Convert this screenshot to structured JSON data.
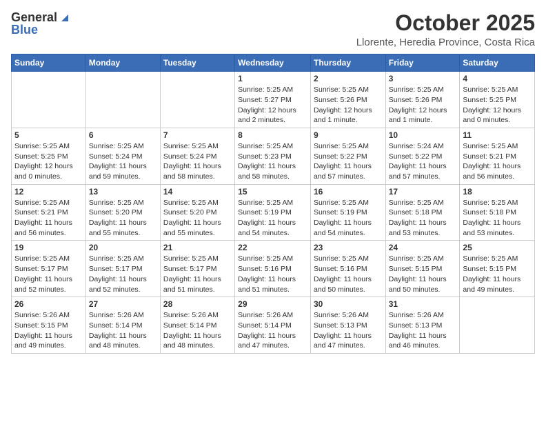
{
  "logo": {
    "general": "General",
    "blue": "Blue"
  },
  "title": "October 2025",
  "location": "Llorente, Heredia Province, Costa Rica",
  "weekdays": [
    "Sunday",
    "Monday",
    "Tuesday",
    "Wednesday",
    "Thursday",
    "Friday",
    "Saturday"
  ],
  "weeks": [
    [
      {
        "day": "",
        "info": ""
      },
      {
        "day": "",
        "info": ""
      },
      {
        "day": "",
        "info": ""
      },
      {
        "day": "1",
        "info": "Sunrise: 5:25 AM\nSunset: 5:27 PM\nDaylight: 12 hours and 2 minutes."
      },
      {
        "day": "2",
        "info": "Sunrise: 5:25 AM\nSunset: 5:26 PM\nDaylight: 12 hours and 1 minute."
      },
      {
        "day": "3",
        "info": "Sunrise: 5:25 AM\nSunset: 5:26 PM\nDaylight: 12 hours and 1 minute."
      },
      {
        "day": "4",
        "info": "Sunrise: 5:25 AM\nSunset: 5:25 PM\nDaylight: 12 hours and 0 minutes."
      }
    ],
    [
      {
        "day": "5",
        "info": "Sunrise: 5:25 AM\nSunset: 5:25 PM\nDaylight: 12 hours and 0 minutes."
      },
      {
        "day": "6",
        "info": "Sunrise: 5:25 AM\nSunset: 5:24 PM\nDaylight: 11 hours and 59 minutes."
      },
      {
        "day": "7",
        "info": "Sunrise: 5:25 AM\nSunset: 5:24 PM\nDaylight: 11 hours and 58 minutes."
      },
      {
        "day": "8",
        "info": "Sunrise: 5:25 AM\nSunset: 5:23 PM\nDaylight: 11 hours and 58 minutes."
      },
      {
        "day": "9",
        "info": "Sunrise: 5:25 AM\nSunset: 5:22 PM\nDaylight: 11 hours and 57 minutes."
      },
      {
        "day": "10",
        "info": "Sunrise: 5:24 AM\nSunset: 5:22 PM\nDaylight: 11 hours and 57 minutes."
      },
      {
        "day": "11",
        "info": "Sunrise: 5:25 AM\nSunset: 5:21 PM\nDaylight: 11 hours and 56 minutes."
      }
    ],
    [
      {
        "day": "12",
        "info": "Sunrise: 5:25 AM\nSunset: 5:21 PM\nDaylight: 11 hours and 56 minutes."
      },
      {
        "day": "13",
        "info": "Sunrise: 5:25 AM\nSunset: 5:20 PM\nDaylight: 11 hours and 55 minutes."
      },
      {
        "day": "14",
        "info": "Sunrise: 5:25 AM\nSunset: 5:20 PM\nDaylight: 11 hours and 55 minutes."
      },
      {
        "day": "15",
        "info": "Sunrise: 5:25 AM\nSunset: 5:19 PM\nDaylight: 11 hours and 54 minutes."
      },
      {
        "day": "16",
        "info": "Sunrise: 5:25 AM\nSunset: 5:19 PM\nDaylight: 11 hours and 54 minutes."
      },
      {
        "day": "17",
        "info": "Sunrise: 5:25 AM\nSunset: 5:18 PM\nDaylight: 11 hours and 53 minutes."
      },
      {
        "day": "18",
        "info": "Sunrise: 5:25 AM\nSunset: 5:18 PM\nDaylight: 11 hours and 53 minutes."
      }
    ],
    [
      {
        "day": "19",
        "info": "Sunrise: 5:25 AM\nSunset: 5:17 PM\nDaylight: 11 hours and 52 minutes."
      },
      {
        "day": "20",
        "info": "Sunrise: 5:25 AM\nSunset: 5:17 PM\nDaylight: 11 hours and 52 minutes."
      },
      {
        "day": "21",
        "info": "Sunrise: 5:25 AM\nSunset: 5:17 PM\nDaylight: 11 hours and 51 minutes."
      },
      {
        "day": "22",
        "info": "Sunrise: 5:25 AM\nSunset: 5:16 PM\nDaylight: 11 hours and 51 minutes."
      },
      {
        "day": "23",
        "info": "Sunrise: 5:25 AM\nSunset: 5:16 PM\nDaylight: 11 hours and 50 minutes."
      },
      {
        "day": "24",
        "info": "Sunrise: 5:25 AM\nSunset: 5:15 PM\nDaylight: 11 hours and 50 minutes."
      },
      {
        "day": "25",
        "info": "Sunrise: 5:25 AM\nSunset: 5:15 PM\nDaylight: 11 hours and 49 minutes."
      }
    ],
    [
      {
        "day": "26",
        "info": "Sunrise: 5:26 AM\nSunset: 5:15 PM\nDaylight: 11 hours and 49 minutes."
      },
      {
        "day": "27",
        "info": "Sunrise: 5:26 AM\nSunset: 5:14 PM\nDaylight: 11 hours and 48 minutes."
      },
      {
        "day": "28",
        "info": "Sunrise: 5:26 AM\nSunset: 5:14 PM\nDaylight: 11 hours and 48 minutes."
      },
      {
        "day": "29",
        "info": "Sunrise: 5:26 AM\nSunset: 5:14 PM\nDaylight: 11 hours and 47 minutes."
      },
      {
        "day": "30",
        "info": "Sunrise: 5:26 AM\nSunset: 5:13 PM\nDaylight: 11 hours and 47 minutes."
      },
      {
        "day": "31",
        "info": "Sunrise: 5:26 AM\nSunset: 5:13 PM\nDaylight: 11 hours and 46 minutes."
      },
      {
        "day": "",
        "info": ""
      }
    ]
  ]
}
